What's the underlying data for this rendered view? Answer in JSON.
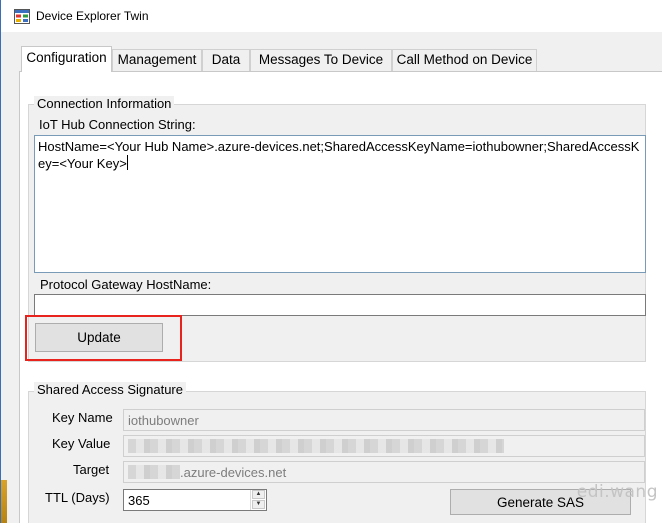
{
  "window": {
    "title": "Device Explorer Twin",
    "accent": "#e8231d"
  },
  "tabs": [
    {
      "label": "Configuration",
      "active": true
    },
    {
      "label": "Management"
    },
    {
      "label": "Data"
    },
    {
      "label": "Messages To Device"
    },
    {
      "label": "Call Method on Device"
    }
  ],
  "connection": {
    "group_title": "Connection Information",
    "conn_string_label": "IoT Hub Connection String:",
    "conn_string_value": "HostName=<Your Hub Name>.azure-devices.net;SharedAccessKeyName=iothubowner;SharedAccessKey=<Your Key>",
    "gateway_label": "Protocol Gateway HostName:",
    "gateway_value": "",
    "update_label": "Update"
  },
  "sas": {
    "group_title": "Shared Access Signature",
    "key_name_label": "Key Name",
    "key_name_value": "iothubowner",
    "key_value_label": "Key Value",
    "key_value_value": "",
    "target_label": "Target",
    "target_value": ".azure-devices.net",
    "ttl_label": "TTL (Days)",
    "ttl_value": "365",
    "generate_label": "Generate SAS"
  },
  "watermark": "edi.wang"
}
